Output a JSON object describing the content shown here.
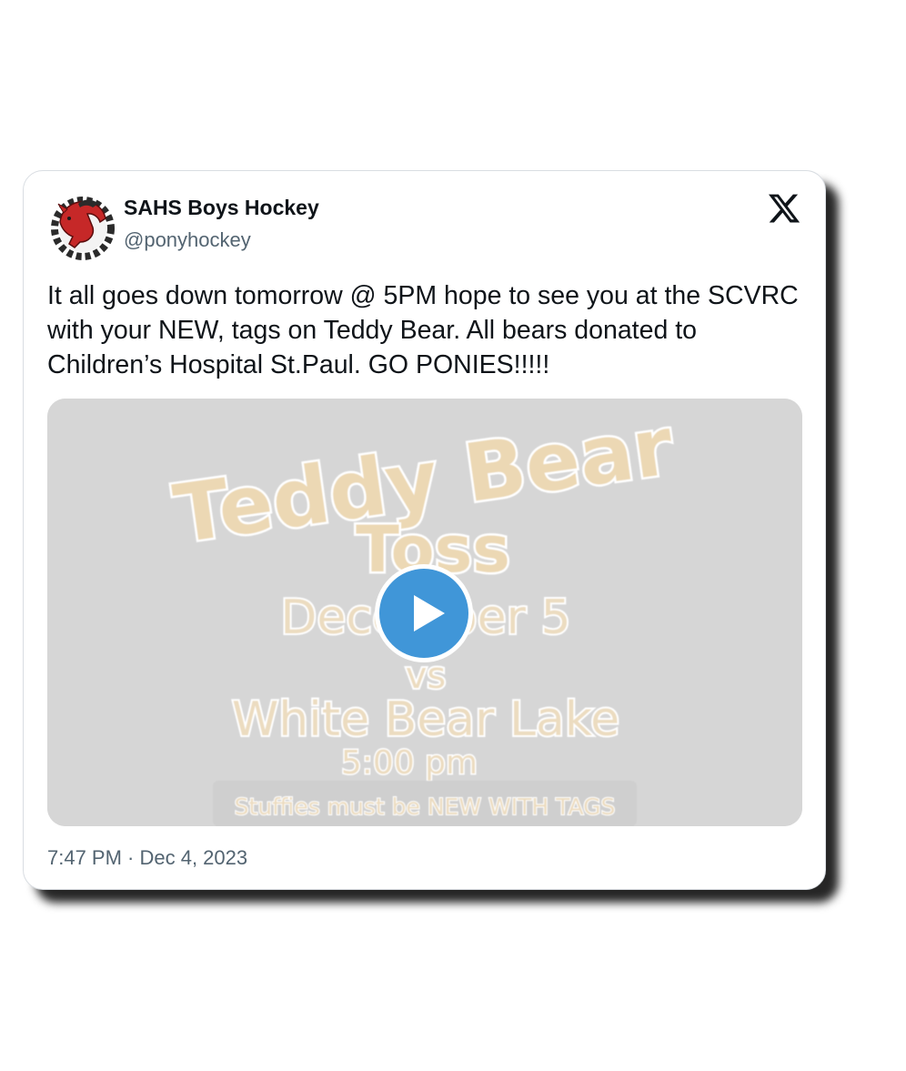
{
  "tweet": {
    "author_name": "SAHS Boys Hockey",
    "author_handle": "@ponyhockey",
    "text": "It all goes down tomorrow @ 5PM hope to see you at the SCVRC with your NEW, tags on Teddy Bear. All bears donated to Children’s Hospital St.Paul. GO PONIES!!!!!",
    "timestamp": "7:47 PM · Dec 4, 2023"
  },
  "platform": {
    "logo_icon": "x-logo-icon"
  },
  "media": {
    "type": "video",
    "play_icon": "play-icon",
    "play_color": "#4096d8",
    "poster": {
      "title_line1": "Teddy Bear",
      "title_line2": "Toss",
      "date_line": "December 5",
      "vs_line": "vs",
      "opponent_line": "White Bear Lake",
      "time_line": "5:00 pm",
      "note_line": "Stuffies must be NEW WITH TAGS"
    }
  },
  "avatar": {
    "icon": "horse-logo-icon",
    "color": "#c62828"
  }
}
